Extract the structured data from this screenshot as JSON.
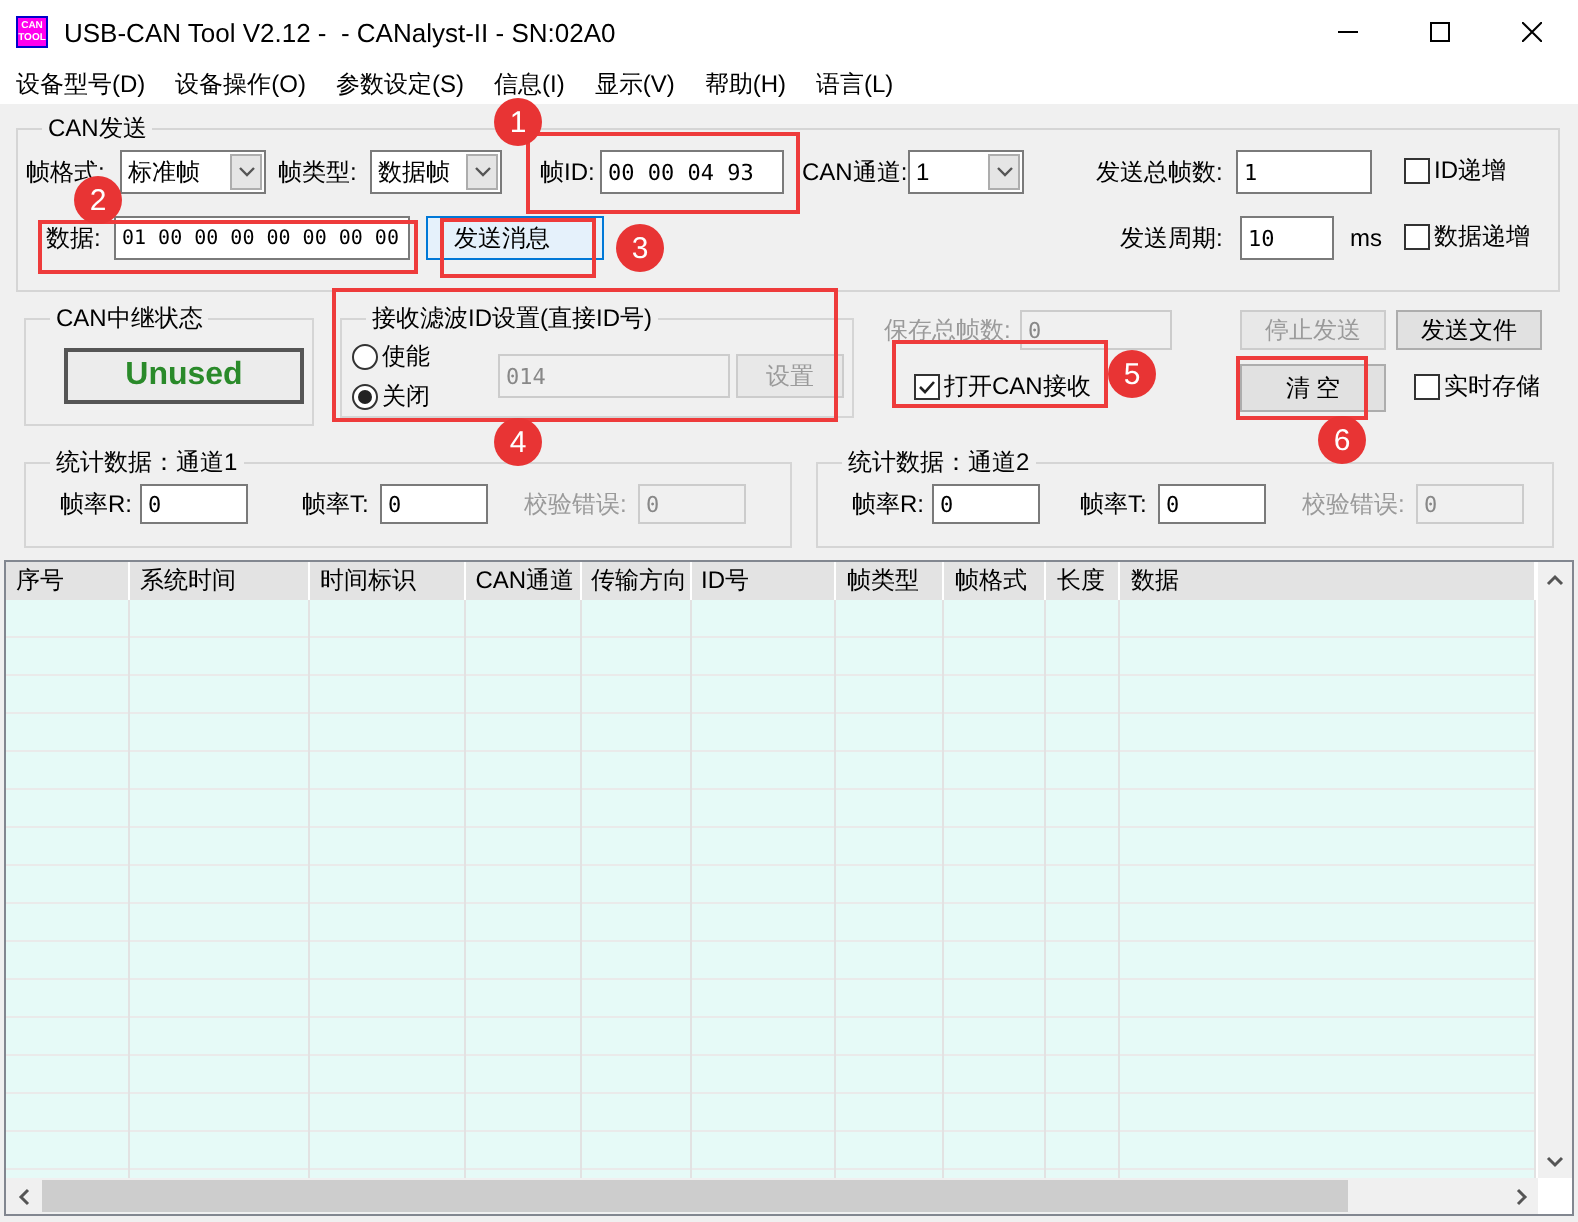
{
  "window": {
    "title": "USB-CAN Tool V2.12 -  - CANalyst-II - SN:02A0",
    "icon_text": [
      "CAN",
      "TOOL"
    ]
  },
  "menu": [
    "设备型号(D)",
    "设备操作(O)",
    "参数设定(S)",
    "信息(I)",
    "显示(V)",
    "帮助(H)",
    "语言(L)"
  ],
  "send": {
    "title": "CAN发送",
    "frame_format": {
      "label": "帧格式:",
      "value": "标准帧"
    },
    "frame_type": {
      "label": "帧类型:",
      "value": "数据帧"
    },
    "frame_id": {
      "label": "帧ID:",
      "value": "00 00 04 93"
    },
    "channel": {
      "label": "CAN通道:",
      "value": "1"
    },
    "total_frames": {
      "label": "发送总帧数:",
      "value": "1"
    },
    "id_increment": {
      "label": "ID递增",
      "checked": false
    },
    "data": {
      "label": "数据:",
      "value": "01 00 00 00 00 00 00 00"
    },
    "send_button": "发送消息",
    "period": {
      "label": "发送周期:",
      "value": "10",
      "unit": "ms"
    },
    "data_increment": {
      "label": "数据递增",
      "checked": false
    }
  },
  "relay": {
    "title": "CAN中继状态",
    "status": "Unused"
  },
  "filter": {
    "title": "接收滤波ID设置(直接ID号)",
    "options": [
      {
        "label": "使能",
        "selected": false
      },
      {
        "label": "关闭",
        "selected": true
      }
    ],
    "id_field": {
      "value": "014",
      "disabled": true
    },
    "set_button": {
      "label": "设置",
      "disabled": true
    }
  },
  "save_total": {
    "label": "保存总帧数:",
    "value": "0",
    "disabled": true
  },
  "open_receive": {
    "label": "打开CAN接收",
    "checked": true
  },
  "stop_button": {
    "label": "停止发送",
    "disabled": true
  },
  "send_file_button": {
    "label": "发送文件",
    "disabled": false
  },
  "clear_button": {
    "label": "清 空",
    "disabled": false
  },
  "realtime_save": {
    "label": "实时存储",
    "checked": false
  },
  "stats": [
    {
      "title": "统计数据：通道1",
      "rate_r": {
        "label": "帧率R:",
        "value": "0"
      },
      "rate_t": {
        "label": "帧率T:",
        "value": "0"
      },
      "check_error": {
        "label": "校验错误:",
        "value": "0",
        "disabled": true
      }
    },
    {
      "title": "统计数据：通道2",
      "rate_r": {
        "label": "帧率R:",
        "value": "0"
      },
      "rate_t": {
        "label": "帧率T:",
        "value": "0"
      },
      "check_error": {
        "label": "校验错误:",
        "value": "0",
        "disabled": true
      }
    }
  ],
  "table": {
    "columns": [
      "序号",
      "系统时间",
      "时间标识",
      "CAN通道",
      "传输方向",
      "ID号",
      "帧类型",
      "帧格式",
      "长度",
      "数据"
    ]
  },
  "annotations": [
    {
      "number": "1"
    },
    {
      "number": "2"
    },
    {
      "number": "3"
    },
    {
      "number": "4"
    },
    {
      "number": "5"
    },
    {
      "number": "6"
    }
  ]
}
